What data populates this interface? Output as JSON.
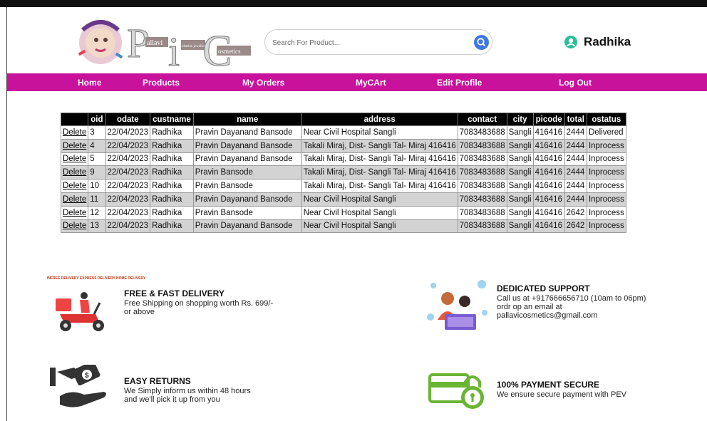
{
  "header": {
    "logo_text": [
      "P",
      "allavi",
      "i",
      "nitation jewellery",
      "C",
      "osmetics"
    ],
    "search_placeholder": "Search For Product...",
    "user_name": "Radhika"
  },
  "nav": {
    "items": [
      "Home",
      "Products",
      "My Orders",
      "MyCArt",
      "Edit Profile",
      "Log Out"
    ]
  },
  "orders": {
    "columns": [
      "",
      "oid",
      "odate",
      "custname",
      "name",
      "address",
      "contact",
      "city",
      "picode",
      "total",
      "ostatus"
    ],
    "action_label": "Delete",
    "rows": [
      [
        "3",
        "22/04/2023",
        "Radhika",
        "Pravin Dayanand Bansode",
        "Near Civil Hospital Sangli",
        "7083483688",
        "Sangli",
        "416416",
        "2444",
        "Delivered"
      ],
      [
        "4",
        "22/04/2023",
        "Radhika",
        "Pravin Dayanand Bansode",
        "Takali Miraj, Dist- Sangli Tal- Miraj 416416",
        "7083483688",
        "Sangli",
        "416416",
        "2444",
        "Inprocess"
      ],
      [
        "5",
        "22/04/2023",
        "Radhika",
        "Pravin Dayanand Bansode",
        "Takali Miraj, Dist- Sangli Tal- Miraj 416416",
        "7083483688",
        "Sangli",
        "416416",
        "2444",
        "Inprocess"
      ],
      [
        "9",
        "22/04/2023",
        "Radhika",
        "Pravin Bansode",
        "Takali Miraj, Dist- Sangli Tal- Miraj 416416",
        "7083483688",
        "Sangli",
        "416416",
        "2444",
        "Inprocess"
      ],
      [
        "10",
        "22/04/2023",
        "Radhika",
        "Pravin Bansode",
        "Takali Miraj, Dist- Sangli Tal- Miraj 416416",
        "7083483688",
        "Sangli",
        "416416",
        "2444",
        "Inprocess"
      ],
      [
        "11",
        "22/04/2023",
        "Radhika",
        "Pravin Dayanand Bansode",
        "Near Civil Hospital Sangli",
        "7083483688",
        "Sangli",
        "416416",
        "2444",
        "Inprocess"
      ],
      [
        "12",
        "22/04/2023",
        "Radhika",
        "Pravin Bansode",
        "Near Civil Hospital Sangli",
        "7083483688",
        "Sangli",
        "416416",
        "2642",
        "Inprocess"
      ],
      [
        "13",
        "22/04/2023",
        "Radhika",
        "Pravin Dayanand Bansode",
        "Near Civil Hospital Sangli",
        "7083483688",
        "Sangli",
        "416416",
        "2642",
        "Inprocess"
      ]
    ]
  },
  "features": {
    "delivery": {
      "title": "FREE & FAST DELIVERY",
      "text": "Free Shipping on shopping worth  Rs. 699/-\n or above",
      "tags": [
        "INFREE DELIVERY",
        "EXPRESS DELIVERY",
        "HOME DELIVERY"
      ]
    },
    "support": {
      "title": "DEDICATED SUPPORT",
      "text": "Call us at +917666656710 (10am to 06pm)\nordr op an email at\npallavicosmetics@gmail.com"
    },
    "returns": {
      "title": "EASY RETURNS",
      "text": "We Simply inform us within 48 hours\nand we'll pick it up from you"
    },
    "payment": {
      "title": "100% PAYMENT SECURE",
      "text": "We ensure secure payment with PEV"
    }
  },
  "colors": {
    "nav_bg": "#c8129c",
    "search_btn": "#3d78e8",
    "user_icon": "#2dbd9a",
    "payment_green": "#6ab533"
  }
}
